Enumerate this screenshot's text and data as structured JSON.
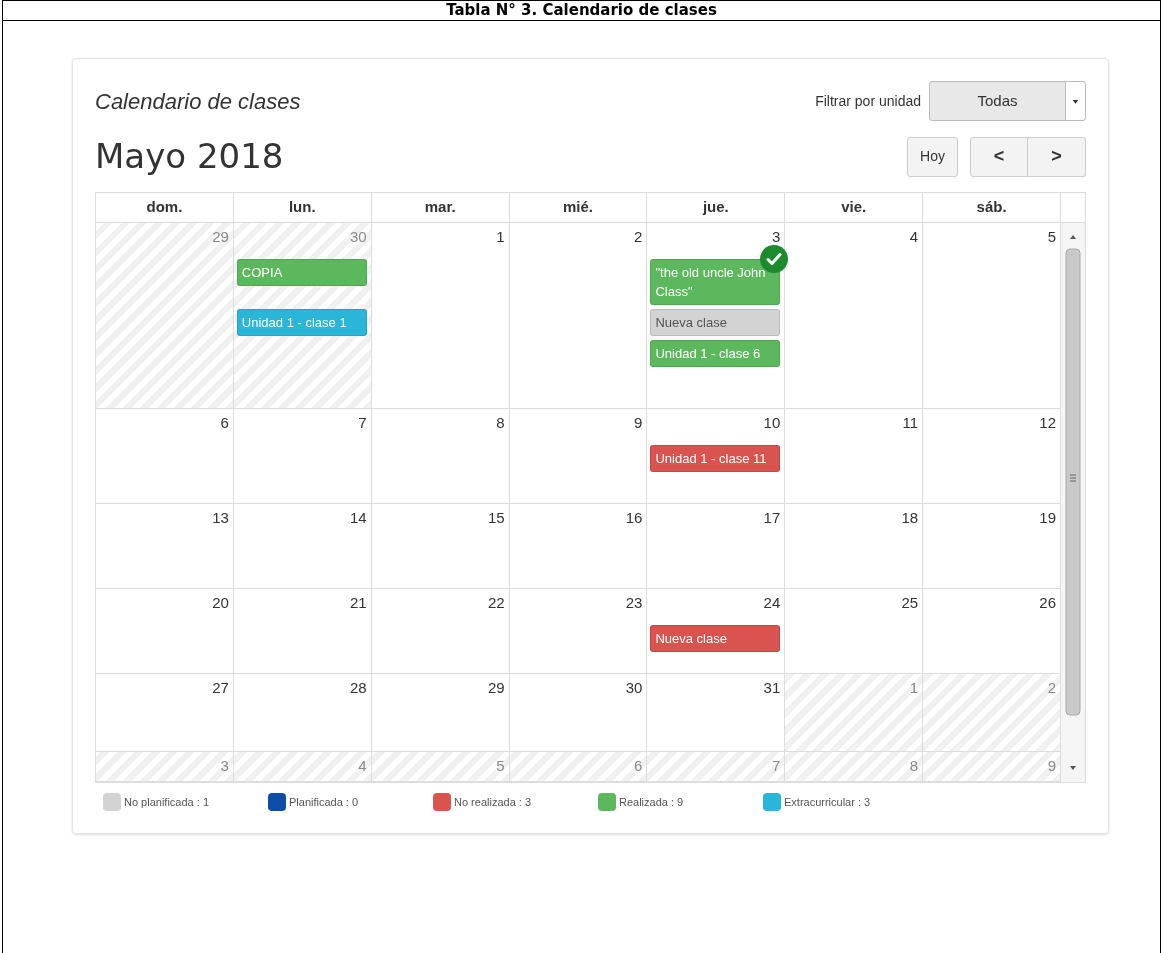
{
  "document_title": "Tabla N° 3. Calendario de clases",
  "card": {
    "title": "Calendario de clases",
    "filter_label": "Filtrar por unidad",
    "filter_value": "Todas",
    "month": "Mayo 2018",
    "today_button": "Hoy",
    "prev_button": "<",
    "next_button": ">"
  },
  "weekdays": [
    "dom.",
    "lun.",
    "mar.",
    "mié.",
    "jue.",
    "vie.",
    "sáb."
  ],
  "weeks": [
    {
      "days": [
        {
          "number": "29",
          "other_month": true
        },
        {
          "number": "30",
          "other_month": true,
          "events": [
            {
              "title": "COPIA",
              "color": "#5cb85c",
              "done": false
            },
            {
              "title": "Unidad 1 - clase 1",
              "color": "#29b6d8",
              "done": false
            }
          ]
        },
        {
          "number": "1",
          "other_month": false
        },
        {
          "number": "2",
          "other_month": false
        },
        {
          "number": "3",
          "other_month": false,
          "events": [
            {
              "title": "\"the old uncle John Class\"",
              "color": "#5cb85c",
              "done": true
            },
            {
              "title": "Nueva clase",
              "color": "#d3d3d3",
              "done": false
            },
            {
              "title": "Unidad 1 - clase 6",
              "color": "#5cb85c",
              "done": false
            }
          ]
        },
        {
          "number": "4",
          "other_month": false
        },
        {
          "number": "5",
          "other_month": false
        }
      ]
    },
    {
      "days": [
        {
          "number": "6",
          "other_month": false
        },
        {
          "number": "7",
          "other_month": false
        },
        {
          "number": "8",
          "other_month": false
        },
        {
          "number": "9",
          "other_month": false
        },
        {
          "number": "10",
          "other_month": false,
          "events": [
            {
              "title": "Unidad 1 - clase 11",
              "color": "#d9534f",
              "done": false
            }
          ]
        },
        {
          "number": "11",
          "other_month": false
        },
        {
          "number": "12",
          "other_month": false
        }
      ]
    },
    {
      "days": [
        {
          "number": "13",
          "other_month": false
        },
        {
          "number": "14",
          "other_month": false
        },
        {
          "number": "15",
          "other_month": false
        },
        {
          "number": "16",
          "other_month": false
        },
        {
          "number": "17",
          "other_month": false
        },
        {
          "number": "18",
          "other_month": false
        },
        {
          "number": "19",
          "other_month": false
        }
      ]
    },
    {
      "days": [
        {
          "number": "20",
          "other_month": false
        },
        {
          "number": "21",
          "other_month": false
        },
        {
          "number": "22",
          "other_month": false
        },
        {
          "number": "23",
          "other_month": false
        },
        {
          "number": "24",
          "other_month": false,
          "events": [
            {
              "title": "Nueva clase",
              "color": "#d9534f",
              "done": false
            }
          ]
        },
        {
          "number": "25",
          "other_month": false
        },
        {
          "number": "26",
          "other_month": false
        }
      ]
    },
    {
      "days": [
        {
          "number": "27",
          "other_month": false
        },
        {
          "number": "28",
          "other_month": false
        },
        {
          "number": "29",
          "other_month": false
        },
        {
          "number": "30",
          "other_month": false
        },
        {
          "number": "31",
          "other_month": false
        },
        {
          "number": "1",
          "other_month": true
        },
        {
          "number": "2",
          "other_month": true
        }
      ]
    },
    {
      "days": [
        {
          "number": "3",
          "other_month": true
        },
        {
          "number": "4",
          "other_month": true
        },
        {
          "number": "5",
          "other_month": true
        },
        {
          "number": "6",
          "other_month": true
        },
        {
          "number": "7",
          "other_month": true
        },
        {
          "number": "8",
          "other_month": true
        },
        {
          "number": "9",
          "other_month": true
        }
      ]
    }
  ],
  "legend": [
    {
      "label": "No planificada : 1",
      "color": "#d3d3d3"
    },
    {
      "label": "Planificada : 0",
      "color": "#0d4fa8"
    },
    {
      "label": "No realizada : 3",
      "color": "#d9534f"
    },
    {
      "label": "Realizada : 9",
      "color": "#5cb85c"
    },
    {
      "label": "Extracurricular : 3",
      "color": "#29b6d8"
    }
  ]
}
